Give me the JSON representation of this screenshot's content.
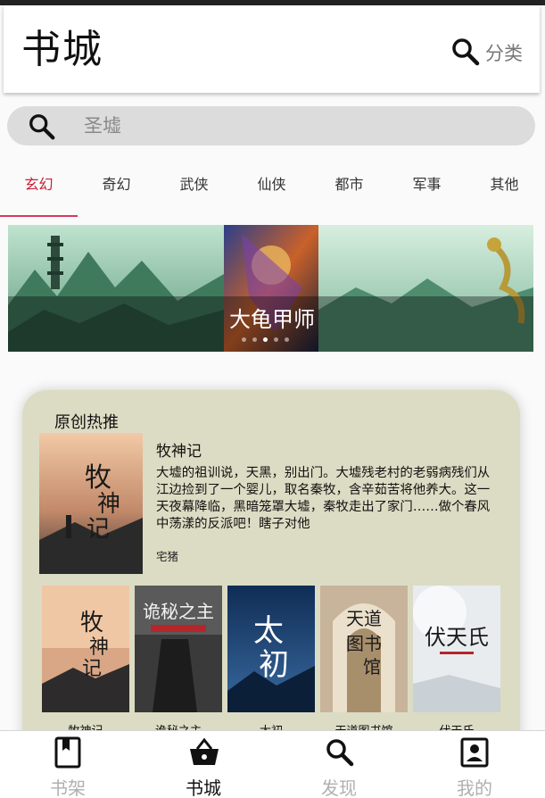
{
  "header": {
    "title": "书城",
    "category_label": "分类"
  },
  "search": {
    "placeholder": "圣墟"
  },
  "tabs": [
    {
      "label": "玄幻",
      "active": true
    },
    {
      "label": "奇幻"
    },
    {
      "label": "武侠"
    },
    {
      "label": "仙侠"
    },
    {
      "label": "都市"
    },
    {
      "label": "军事"
    },
    {
      "label": "其他"
    }
  ],
  "banner": {
    "caption": "大龟甲师",
    "dot_count": 5,
    "active_dot": 3
  },
  "featured": {
    "section_title": "原创热推",
    "book": {
      "title": "牧神记",
      "description": "大墟的祖训说，天黑，别出门。大墟残老村的老弱病残们从江边捡到了一个婴儿，取名秦牧，含辛茹苦将他养大。这一天夜幕降临，黑暗笼罩大墟，秦牧走出了家门……做个春风中荡漾的反派吧！瞎子对他",
      "author": "宅猪"
    },
    "books": [
      {
        "title": "牧神记"
      },
      {
        "title": "诡秘之主"
      },
      {
        "title": "太初"
      },
      {
        "title": "天道图书馆"
      },
      {
        "title": "伏天氏"
      }
    ]
  },
  "bottom_nav": [
    {
      "label": "书架",
      "icon": "book-icon"
    },
    {
      "label": "书城",
      "icon": "basket-icon",
      "active": true
    },
    {
      "label": "发现",
      "icon": "search-icon"
    },
    {
      "label": "我的",
      "icon": "profile-icon"
    }
  ],
  "colors": {
    "accent": "#c81d35",
    "card_bg": "#dcdcc4",
    "search_bg": "#dcdcdc"
  }
}
